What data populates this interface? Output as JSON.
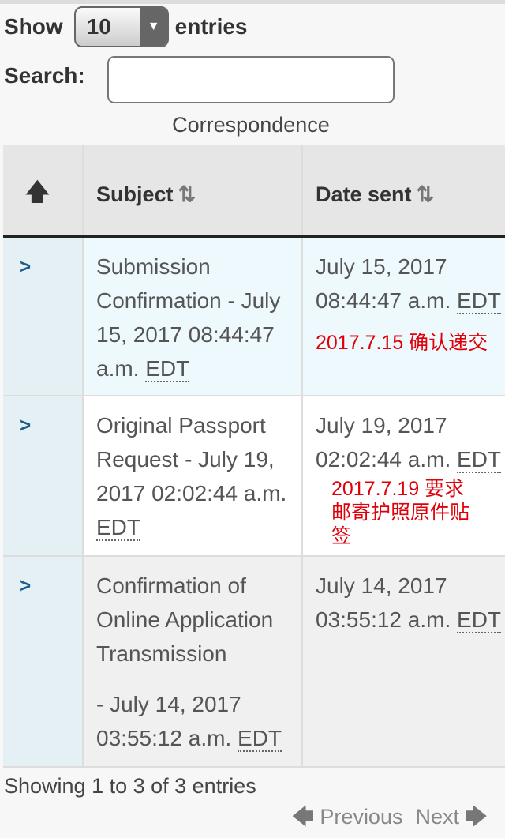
{
  "length_menu": {
    "show_label": "Show",
    "value": "10",
    "entries_label": "entries"
  },
  "search": {
    "label": "Search:",
    "value": ""
  },
  "caption": "Correspondence",
  "columns": [
    {
      "label": "",
      "icon": "arrow-up-icon"
    },
    {
      "label": "Subject",
      "icon": "sort-icon"
    },
    {
      "label": "Date sent",
      "icon": "sort-icon"
    }
  ],
  "rows": [
    {
      "subject": "Submission Confirmation - July 15, 2017 08:44:47 a.m.",
      "subject_tz": "EDT",
      "date": "July 15, 2017 08:44:47 a.m.",
      "date_tz": "EDT",
      "note": "2017.7.15 确认递交"
    },
    {
      "subject": "Original Passport Request - July 19, 2017 02:02:44 a.m.",
      "subject_tz": "EDT",
      "date": "July 19, 2017 02:02:44 a.m.",
      "date_tz": "EDT",
      "note": "2017.7.19 要求邮寄护照原件贴签"
    },
    {
      "subject": "Confirmation of Online Application Transmission",
      "subject2": "- July 14, 2017 03:55:12 a.m.",
      "subject_tz": "EDT",
      "date": "July 14, 2017 03:55:12 a.m.",
      "date_tz": "EDT"
    }
  ],
  "info": "Showing 1 to 3 of 3 entries",
  "pager": {
    "previous": "Previous",
    "next": "Next"
  },
  "colors": {
    "annotation": "#e0000a",
    "row_highlight": "#eef9fd",
    "expand": "#1e5b8c"
  }
}
